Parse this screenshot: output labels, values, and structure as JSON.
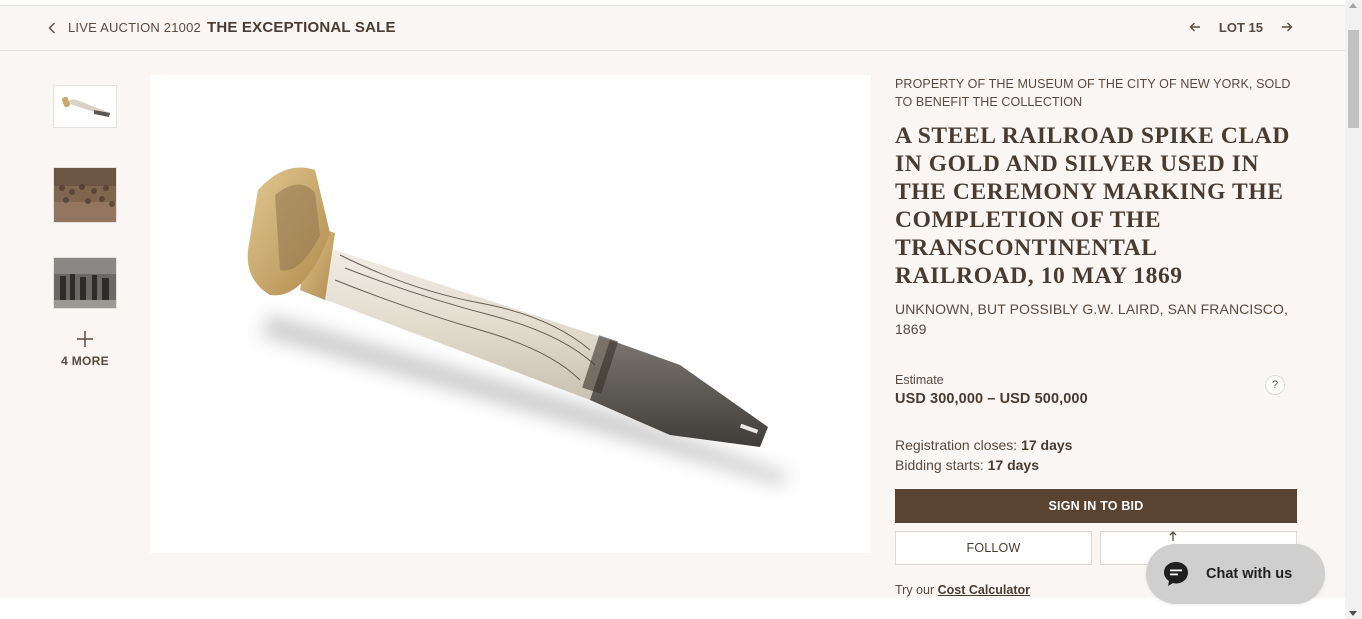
{
  "header": {
    "auction_prefix": "LIVE AUCTION 21002",
    "auction_title": "THE EXCEPTIONAL SALE",
    "lot_label": "LOT 15"
  },
  "gallery": {
    "more_label": "4 MORE"
  },
  "details": {
    "provenance": "PROPERTY OF THE MUSEUM OF THE CITY OF NEW YORK, SOLD TO BENEFIT THE COLLECTION",
    "title": "A STEEL RAILROAD SPIKE CLAD IN GOLD AND SILVER USED IN THE CEREMONY MARKING THE COMPLETION OF THE TRANSCONTINENTAL RAILROAD, 10 MAY 1869",
    "maker": "UNKNOWN, BUT POSSIBLY G.W. LAIRD, SAN FRANCISCO, 1869",
    "estimate_label": "Estimate",
    "estimate_value": "USD 300,000 – USD 500,000",
    "help_label": "?",
    "registration_label": "Registration closes: ",
    "registration_value": "17 days",
    "bidding_label": "Bidding starts: ",
    "bidding_value": "17 days",
    "sign_in_label": "SIGN IN TO BID",
    "follow_label": "FOLLOW",
    "calc_prefix": "Try our ",
    "calc_link": "Cost Calculator"
  },
  "chat": {
    "label": "Chat with us"
  },
  "colors": {
    "background": "#f9f6f3",
    "accent_brown": "#5a4330",
    "text": "#5a4a3e",
    "chat_bg": "#cfcfcf"
  },
  "icons": [
    "chevron-left-icon",
    "arrow-left-icon",
    "arrow-right-icon",
    "plus-icon",
    "help-icon",
    "share-icon",
    "chat-bubble-icon"
  ]
}
